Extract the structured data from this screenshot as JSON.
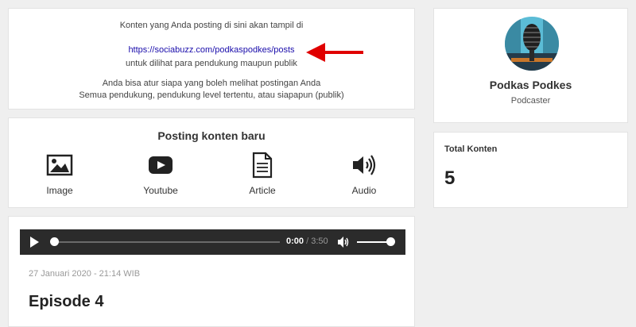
{
  "info": {
    "line1": "Konten yang Anda posting di sini akan tampil di",
    "link": "https://sociabuzz.com/podkaspodkes/posts",
    "line3": "untuk dilihat para pendukung maupun publik",
    "line4": "Anda bisa atur siapa yang boleh melihat postingan Anda",
    "line5": "Semua pendukung, pendukung level tertentu, atau siapapun (publik)"
  },
  "post_new": {
    "title": "Posting konten baru",
    "types": [
      {
        "label": "Image",
        "icon": "image-icon"
      },
      {
        "label": "Youtube",
        "icon": "youtube-icon"
      },
      {
        "label": "Article",
        "icon": "article-icon"
      },
      {
        "label": "Audio",
        "icon": "audio-icon"
      }
    ]
  },
  "episode": {
    "current_time": "0:00",
    "separator": "/",
    "duration": "3:50",
    "progress": 0,
    "volume": 1,
    "date": "27 Januari 2020 - 21:14 WIB",
    "title": "Episode 4"
  },
  "profile": {
    "name": "Podkas Podkes",
    "role": "Podcaster"
  },
  "total": {
    "label": "Total Konten",
    "value": "5"
  },
  "colors": {
    "link": "#1a0dab",
    "arrow": "#e00000",
    "player_bg": "#2b2b2b",
    "page_bg": "#efefef"
  }
}
